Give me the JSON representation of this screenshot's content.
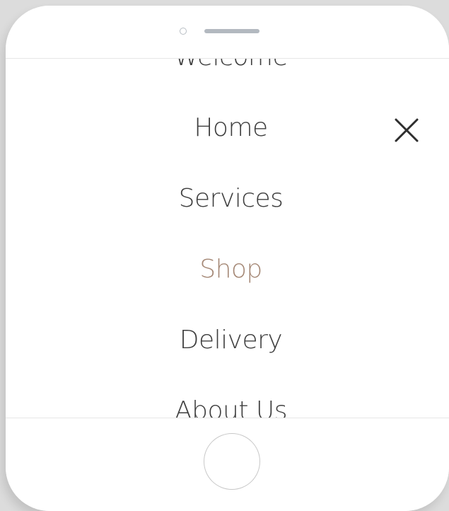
{
  "menu": {
    "items": [
      {
        "label": "Welcome",
        "active": false
      },
      {
        "label": "Home",
        "active": false
      },
      {
        "label": "Services",
        "active": false
      },
      {
        "label": "Shop",
        "active": true
      },
      {
        "label": "Delivery",
        "active": false
      },
      {
        "label": "About Us",
        "active": false
      }
    ],
    "active_color": "#a58876",
    "text_color": "#3e3e3e"
  },
  "close_icon": "close-icon",
  "device": {
    "camera_icon": "camera-icon",
    "speaker_icon": "speaker-grille",
    "home_button_icon": "home-button"
  }
}
